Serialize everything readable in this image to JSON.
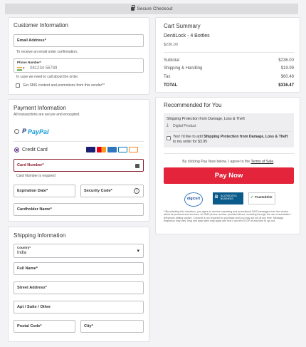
{
  "topbar": {
    "label": "Secure Checkout"
  },
  "customer": {
    "title": "Customer Information",
    "email_label": "Email Address*",
    "email_hint": "To receive an email order confirmation.",
    "phone_label": "Phone Number*",
    "phone_placeholder": "081234 56789",
    "phone_hint": "In case we need to call about the order.",
    "sms_label": "Get SMS content and promotions from this vendor**"
  },
  "payment": {
    "title": "Payment Information",
    "subtitle": "All transactions are secure and encrypted.",
    "paypal_label": "PayPal",
    "credit_label": "Credit Card",
    "card_number_label": "Card Number*",
    "card_number_error": "Card Number is required",
    "expiration_label": "Expiration Date*",
    "security_label": "Security Code*",
    "cardholder_label": "Cardholder Name*",
    "card_brands": [
      "VISA",
      "MC",
      "AMEX",
      "DC",
      "DISCOVER"
    ]
  },
  "shipping": {
    "title": "Shipping Information",
    "country_label": "Country*",
    "country_value": "India",
    "full_name_label": "Full Name*",
    "street_label": "Street Address*",
    "apt_label": "Apt / Suite / Other",
    "postal_label": "Postal Code*",
    "city_label": "City*"
  },
  "cart": {
    "title": "Cart Summary",
    "product_name": "DentiLock - 4 Bottles",
    "product_price": "$236.00",
    "rows": [
      {
        "label": "Subtotal",
        "value": "$236.00"
      },
      {
        "label": "Shipping & Handling",
        "value": "$19.99"
      },
      {
        "label": "Tax",
        "value": "$60.48"
      }
    ],
    "total_label": "TOTAL",
    "total_value": "$316.47"
  },
  "recommend": {
    "title": "Recommended for You",
    "product": "Shipping Protection from Damage, Loss & Theft",
    "type": "Digital Product",
    "offer_prefix": "Yes! I'd like to add ",
    "offer_bold": "Shipping Protection from Damage, Loss & Theft",
    "offer_suffix": " to my order for $3.95"
  },
  "checkout": {
    "terms_prefix": "By clicking Pay Now below, I agree to the ",
    "terms_link": "Terms of Sale",
    "terms_suffix": ".",
    "pay_label": "Pay Now",
    "badges": [
      "digicert",
      "ACCREDITED BUSINESS",
      "TrustedSite"
    ],
    "disclaimer": "**By selecting this checkbox, you agree to receive marketing and promotional SMS messages from the vendor about its products and services. An SMS phone number provided above, including through the use of autodialer / telephone dialing system. Consent is not required for purchase and you may opt out at any time. Message frequency may vary. Msg and data rates may apply and that I can text STOP at any time to opt out."
  },
  "colors": {
    "accent": "#5b2a86",
    "paynow": "#e3243b",
    "error": "#8b1c2c"
  }
}
